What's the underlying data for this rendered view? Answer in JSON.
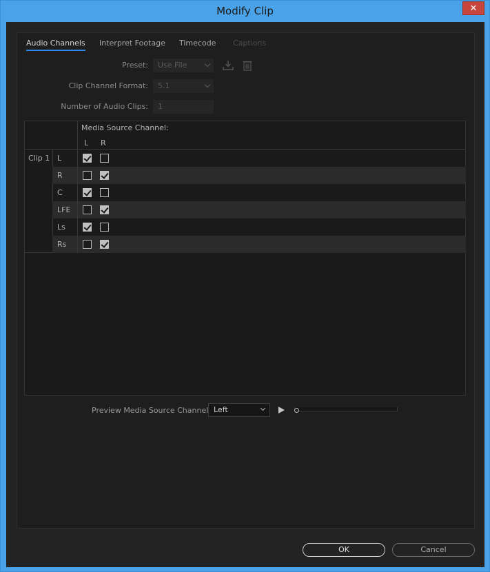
{
  "window": {
    "title": "Modify Clip",
    "close_glyph": "✕"
  },
  "tabs": [
    {
      "label": "Audio Channels",
      "state": "active"
    },
    {
      "label": "Interpret Footage",
      "state": "normal"
    },
    {
      "label": "Timecode",
      "state": "normal"
    },
    {
      "label": "Captions",
      "state": "disabled"
    }
  ],
  "form": {
    "preset_label": "Preset:",
    "preset_value": "Use File",
    "clip_channel_format_label": "Clip Channel Format:",
    "clip_channel_format_value": "5.1",
    "number_of_audio_clips_label": "Number of Audio Clips:",
    "number_of_audio_clips_value": "1"
  },
  "channel_grid": {
    "header": "Media Source Channel:",
    "source_channels": [
      "L",
      "R"
    ],
    "clip_label": "Clip 1",
    "rows": [
      {
        "label": "L",
        "checks": [
          true,
          false
        ]
      },
      {
        "label": "R",
        "checks": [
          false,
          true
        ]
      },
      {
        "label": "C",
        "checks": [
          true,
          false
        ]
      },
      {
        "label": "LFE",
        "checks": [
          false,
          true
        ]
      },
      {
        "label": "Ls",
        "checks": [
          true,
          false
        ]
      },
      {
        "label": "Rs",
        "checks": [
          false,
          true
        ]
      }
    ]
  },
  "preview": {
    "label": "Preview Media Source Channel:",
    "selected": "Left"
  },
  "buttons": {
    "ok": "OK",
    "cancel": "Cancel"
  }
}
